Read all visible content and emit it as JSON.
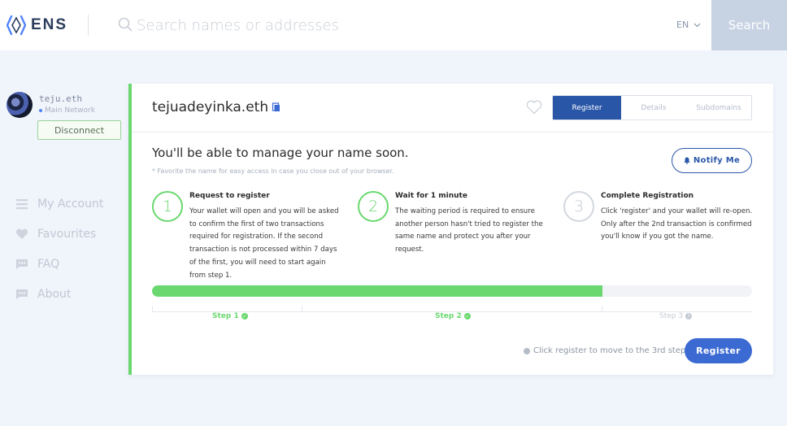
{
  "header": {
    "logo_text": "ENS",
    "search_placeholder": "Search names or addresses",
    "language": "EN",
    "search_button": "Search"
  },
  "account": {
    "name": "teju.eth",
    "network": "Main Network",
    "disconnect_label": "Disconnect"
  },
  "sidebar": {
    "items": [
      {
        "label": "My Account",
        "icon": "person-icon"
      },
      {
        "label": "Favourites",
        "icon": "heart-icon"
      },
      {
        "label": "FAQ",
        "icon": "chat-icon"
      },
      {
        "label": "About",
        "icon": "chat-icon"
      }
    ]
  },
  "card": {
    "domain": "tejuadeyinka.eth",
    "tabs": [
      {
        "label": "Register",
        "active": true
      },
      {
        "label": "Details",
        "active": false
      },
      {
        "label": "Subdomains",
        "active": false
      }
    ],
    "heading": "You'll be able to manage your name soon.",
    "favorite_note": "* Favorite the name for easy access in case you close out of your browser.",
    "notify_label": "Notify Me",
    "steps": [
      {
        "number": "1",
        "title": "Request to register",
        "text": "Your wallet will open and you will be asked to confirm the first of two transactions required for registration. If the second transaction is not processed within 7 days of the first, you will need to start again from step 1."
      },
      {
        "number": "2",
        "title": "Wait for 1 minute",
        "text": "The waiting period is required to ensure another person hasn't tried to register the same name and protect you after your request."
      },
      {
        "number": "3",
        "title": "Complete Registration",
        "text": "Click 'register' and your wallet will re-open. Only after the 2nd transaction is confirmed you'll know if you got the name."
      }
    ],
    "progress_fraction": 0.75,
    "step_labels": [
      "Step 1",
      "Step 2",
      "Step 3"
    ],
    "hint": "Click register to move to the 3rd step",
    "register_label": "Register"
  },
  "colors": {
    "accent_blue": "#2a56a8",
    "success_green": "#6ad86f",
    "search_button_bg": "#c7d3e3"
  }
}
